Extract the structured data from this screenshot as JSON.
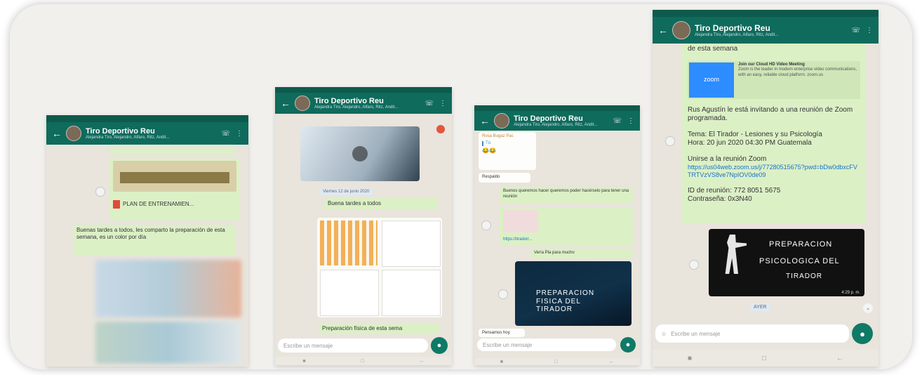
{
  "colors": {
    "header": "#0f6b5c",
    "outgoing": "#dcf0c6",
    "incoming": "#fdfdfb",
    "accent": "#0f7a66"
  },
  "chat": {
    "title": "Tiro Deportivo Reu",
    "subtitle": "Alejandra Tiro, Alejandro, Alfaro, Ritz, Andit..."
  },
  "phone1": {
    "doc_label": "PLAN DE ENTRENAMIEN...",
    "message": "Buenas tardes a todos, les comparto la preparación de esta semana, es un color por día"
  },
  "phone2": {
    "date_pill": "Viernes 12 de junio 2020",
    "greeting": "Buena tardes a todos",
    "caption": "Preparación física de esta sema"
  },
  "phone3": {
    "sender": "Rosa Bugaz Pac",
    "quoted_name": "Tú",
    "reply_emojis": "😂😂",
    "reply_label": "Respaldo",
    "message1": "Buenos queremos hacer queremos poder hacérselo para tener una reunión",
    "link": "https://tiradorr...",
    "caption": "Vería Pla para mucho",
    "image_text": "PREPARACION FISICA DEL TIRADOR",
    "footer_text": "Pensamos hoy"
  },
  "phone4": {
    "top_text": "de esta semana",
    "zoom_logo": "zoom",
    "zoom_title": "Join our Cloud HD Video Meeting",
    "zoom_desc": "Zoom is the leader in modern enterprise video communications, with an easy, reliable cloud platform. zoom.us",
    "invite": "Rus Agustín le está invitando a una reunión de Zoom programada.",
    "topic": "Tema: El Tirador - Lesiones y su Psicología",
    "time": "Hora: 20 jun 2020 04:30 PM Guatemala",
    "join_label": "Unirse a la reunión Zoom",
    "join_link": "https://us04web.zoom.us/j/77280515675?pwd=bDw0dbxcFVTRTVzVS8ve7NpIOV0de09",
    "meeting_id": "ID de reunión: 772 8051 5675",
    "password": "Contraseña: 0x3N40",
    "image_line1": "PREPARACION",
    "image_line2": "PSICOLOGICA DEL",
    "image_line3": "TIRADOR",
    "image_time": "4:29 p. m.",
    "seen_pill": "AYER",
    "input_placeholder": "Escribe un mensaje"
  }
}
